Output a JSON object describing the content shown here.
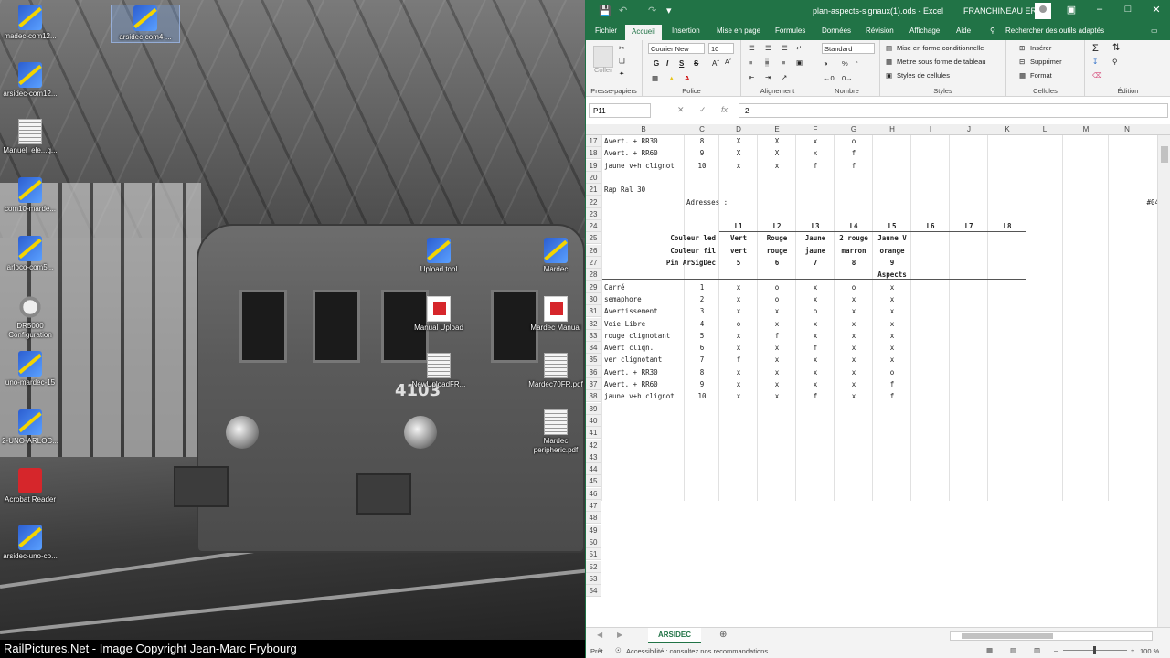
{
  "desktop": {
    "icons": [
      {
        "label": "madec-com12...",
        "type": "exe"
      },
      {
        "label": "arsidec-com4-...",
        "type": "exe"
      },
      {
        "label": "arsidec-com12...",
        "type": "exe"
      },
      {
        "label": "Manuel_ele...g...",
        "type": "doc"
      },
      {
        "label": "com10-marde...",
        "type": "exe"
      },
      {
        "label": "arloco-com5...",
        "type": "exe"
      },
      {
        "label": "DR5000\nConfiguration",
        "type": "cfg"
      },
      {
        "label": "uno-mardec-15",
        "type": "exe"
      },
      {
        "label": "2-UNO-ARLOC...",
        "type": "exe"
      },
      {
        "label": "Acrobat Reader",
        "type": "acrobat"
      },
      {
        "label": "arsidec-uno-co...",
        "type": "exe"
      },
      {
        "label": "Upload tool",
        "type": "exe"
      },
      {
        "label": "Mardec",
        "type": "exe"
      },
      {
        "label": "Manual Upload",
        "type": "pdf"
      },
      {
        "label": "Mardec Manual",
        "type": "pdf"
      },
      {
        "label": "NewUploadFR...",
        "type": "doc"
      },
      {
        "label": "Mardec70FR.pdf",
        "type": "doc"
      },
      {
        "label": "Mardec\nperipheric.pdf",
        "type": "doc"
      }
    ],
    "train_number": "4103",
    "watermark": "RailPictures.Net - Image Copyright Jean-Marc Frybourg"
  },
  "excel": {
    "title": "plan-aspects-signaux(1).ods  -  Excel",
    "user": "FRANCHINEAU ERIC",
    "tabs": [
      "Fichier",
      "Accueil",
      "Insertion",
      "Mise en page",
      "Formules",
      "Données",
      "Révision",
      "Affichage",
      "Aide",
      "Rechercher des outils adaptés"
    ],
    "ribbon": {
      "groups": [
        "Presse-papiers",
        "Police",
        "Alignement",
        "Nombre",
        "Styles",
        "Cellules",
        "Édition"
      ],
      "paste": "Coller",
      "font_name": "Courier New",
      "font_size": "10",
      "number_format": "Standard",
      "cond_format": "Mise en forme conditionnelle",
      "format_table": "Mettre sous forme de tableau",
      "cell_styles": "Styles de cellules",
      "insert": "Insérer",
      "delete": "Supprimer",
      "format": "Format",
      "bold": "G",
      "italic": "I",
      "underline": "S",
      "strike": "S"
    },
    "namebox": "P11",
    "formula": "2",
    "columns": [
      "B",
      "C",
      "D",
      "E",
      "F",
      "G",
      "H",
      "I",
      "J",
      "K",
      "L",
      "M",
      "N"
    ],
    "rows": [
      {
        "n": "17",
        "cells": {
          "B": "Avert. + RR30",
          "C": "8",
          "D": "X",
          "E": "X",
          "F": "x",
          "G": "o"
        }
      },
      {
        "n": "18",
        "cells": {
          "B": "Avert. + RR60",
          "C": "9",
          "D": "X",
          "E": "X",
          "F": "x",
          "G": "f"
        }
      },
      {
        "n": "19",
        "cells": {
          "B": "jaune v+h clignot",
          "C": "10",
          "D": "x",
          "E": "x",
          "F": "f",
          "G": "f"
        }
      },
      {
        "n": "20",
        "cells": {}
      },
      {
        "n": "21",
        "cells": {
          "B": "Rap Ral 30"
        }
      },
      {
        "n": "22",
        "cells": {
          "C": "Adresses :",
          "N": "#04"
        }
      },
      {
        "n": "23",
        "cells": {}
      },
      {
        "n": "24",
        "cells": {
          "D": "L1",
          "E": "L2",
          "F": "L3",
          "G": "L4",
          "H": "L5",
          "I": "L6",
          "J": "L7",
          "K": "L8"
        }
      },
      {
        "n": "25",
        "cells": {
          "C": "Couleur led",
          "D": "Vert",
          "E": "Rouge",
          "F": "Jaune",
          "G": "2 rouge",
          "H": "Jaune V"
        }
      },
      {
        "n": "26",
        "cells": {
          "C": "Couleur fil",
          "D": "vert",
          "E": "rouge",
          "F": "jaune",
          "G": "marron",
          "H": "orange"
        }
      },
      {
        "n": "27",
        "cells": {
          "C": "Pin ArSigDec",
          "D": "5",
          "E": "6",
          "F": "7",
          "G": "8",
          "H": "9"
        }
      },
      {
        "n": "28",
        "cells": {
          "H": "Aspects"
        }
      },
      {
        "n": "29",
        "cells": {
          "B": "Carré",
          "C": "1",
          "D": "x",
          "E": "o",
          "F": "x",
          "G": "o",
          "H": "x"
        }
      },
      {
        "n": "30",
        "cells": {
          "B": "semaphore",
          "C": "2",
          "D": "x",
          "E": "o",
          "F": "x",
          "G": "x",
          "H": "x"
        }
      },
      {
        "n": "31",
        "cells": {
          "B": "Avertissement",
          "C": "3",
          "D": "x",
          "E": "x",
          "F": "o",
          "G": "x",
          "H": "x"
        }
      },
      {
        "n": "32",
        "cells": {
          "B": "Voie Libre",
          "C": "4",
          "D": "o",
          "E": "x",
          "F": "x",
          "G": "x",
          "H": "x"
        }
      },
      {
        "n": "33",
        "cells": {
          "B": "rouge clignotant",
          "C": "5",
          "D": "x",
          "E": "f",
          "F": "x",
          "G": "x",
          "H": "x"
        }
      },
      {
        "n": "34",
        "cells": {
          "B": "Avert cliqn.",
          "C": "6",
          "D": "x",
          "E": "x",
          "F": "f",
          "G": "x",
          "H": "x"
        }
      },
      {
        "n": "35",
        "cells": {
          "B": "ver clignotant",
          "C": "7",
          "D": "f",
          "E": "x",
          "F": "x",
          "G": "x",
          "H": "x"
        }
      },
      {
        "n": "36",
        "cells": {
          "B": "Avert. + RR30",
          "C": "8",
          "D": "x",
          "E": "x",
          "F": "x",
          "G": "x",
          "H": "o"
        }
      },
      {
        "n": "37",
        "cells": {
          "B": "Avert. + RR60",
          "C": "9",
          "D": "x",
          "E": "x",
          "F": "x",
          "G": "x",
          "H": "f"
        }
      },
      {
        "n": "38",
        "cells": {
          "B": "jaune v+h clignot",
          "C": "10",
          "D": "x",
          "E": "x",
          "F": "f",
          "G": "x",
          "H": "f"
        }
      },
      {
        "n": "39",
        "cells": {}
      },
      {
        "n": "40",
        "cells": {}
      },
      {
        "n": "41",
        "cells": {}
      },
      {
        "n": "42",
        "cells": {}
      },
      {
        "n": "43",
        "cells": {}
      },
      {
        "n": "44",
        "cells": {}
      },
      {
        "n": "45",
        "cells": {}
      },
      {
        "n": "46",
        "cells": {}
      },
      {
        "n": "47",
        "cells": {}
      },
      {
        "n": "48",
        "cells": {}
      },
      {
        "n": "49",
        "cells": {}
      },
      {
        "n": "50",
        "cells": {}
      },
      {
        "n": "51",
        "cells": {}
      },
      {
        "n": "52",
        "cells": {}
      },
      {
        "n": "53",
        "cells": {}
      },
      {
        "n": "54",
        "cells": {}
      }
    ],
    "sheet_tab": "ARSIDEC",
    "status_ready": "Prêt",
    "status_accessibility": "Accessibilité : consultez nos recommandations",
    "zoom": "100 %"
  }
}
